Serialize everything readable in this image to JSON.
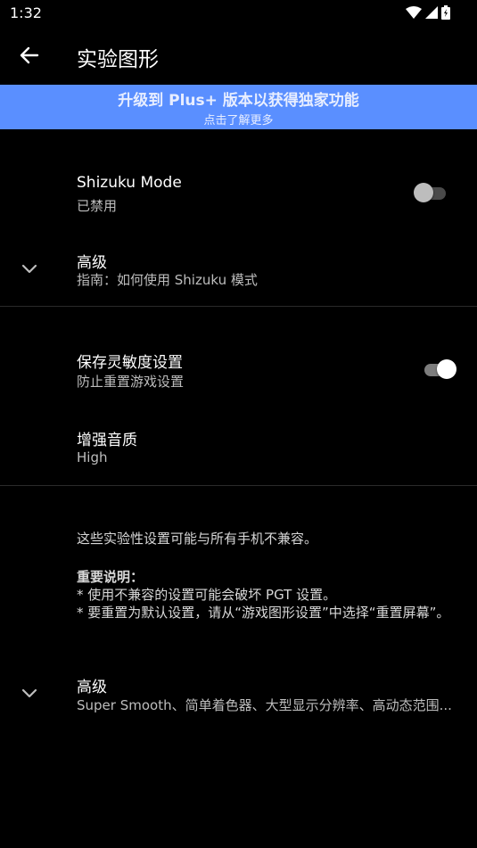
{
  "status_bar": {
    "time": "1:32"
  },
  "app_bar": {
    "title": "实验图形"
  },
  "promo": {
    "title": "升级到 Plus+ 版本以获得独家功能",
    "subtitle": "点击了解更多"
  },
  "section1": {
    "shizuku": {
      "title": "Shizuku Mode",
      "subtitle": "已禁用",
      "enabled": false
    },
    "advanced": {
      "title": "高级",
      "subtitle": "指南：如何使用 Shizuku 模式"
    }
  },
  "section2": {
    "save_sensitivity": {
      "title": "保存灵敏度设置",
      "subtitle": "防止重置游戏设置",
      "enabled": true
    },
    "audio_quality": {
      "title": "增强音质",
      "subtitle": "High"
    }
  },
  "section3": {
    "info_line1": "这些实验性设置可能与所有手机不兼容。",
    "important_label": "重要说明：",
    "note1": "* 使用不兼容的设置可能会破坏 PGT 设置。",
    "note2": "* 要重置为默认设置，请从“游戏图形设置”中选择“重置屏幕”。",
    "advanced": {
      "title": "高级",
      "subtitle": "Super Smooth、简单着色器、大型显示分辨率、高动态范围..."
    }
  },
  "colors": {
    "accent_banner": "#5a8fff",
    "switch_on_thumb": "#ffffff",
    "switch_off_thumb": "#bdbdbd"
  }
}
